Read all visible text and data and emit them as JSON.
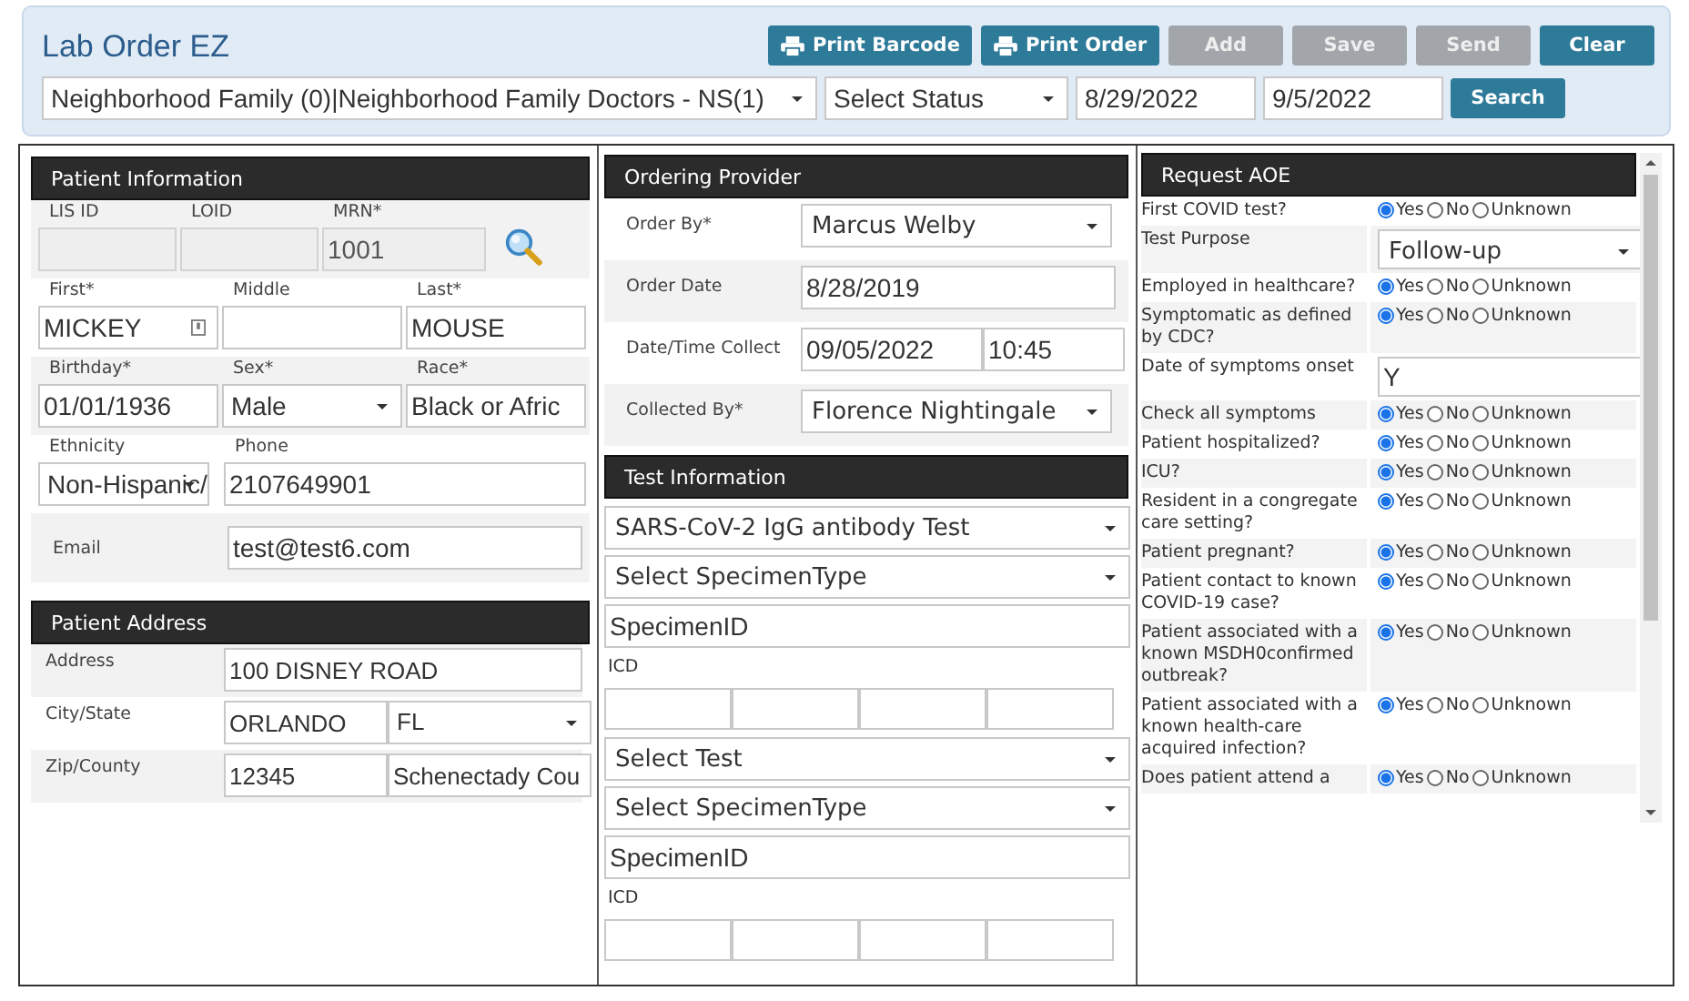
{
  "header": {
    "title": "Lab Order EZ",
    "buttons": [
      {
        "label": "Print Barcode",
        "kind": "print",
        "disabled": false
      },
      {
        "label": "Print Order",
        "kind": "print",
        "disabled": false
      },
      {
        "label": "Add",
        "kind": "plain",
        "disabled": true
      },
      {
        "label": "Save",
        "kind": "plain",
        "disabled": true
      },
      {
        "label": "Send",
        "kind": "plain",
        "disabled": true
      },
      {
        "label": "Clear",
        "kind": "plain",
        "disabled": false
      }
    ]
  },
  "filters": {
    "facility": "Neighborhood Family (0)|Neighborhood Family Doctors - NS(1)",
    "status": "Select Status",
    "date_from": "8/29/2022",
    "date_to": "9/5/2022",
    "search_button": "Search"
  },
  "patient_information": {
    "title": "Patient Information",
    "rows": [
      {
        "kind": "stacked-lookup",
        "fields": [
          {
            "label": "LIS ID",
            "kind": "input",
            "disabled": true
          },
          {
            "label": "LOID",
            "kind": "input",
            "disabled": true
          },
          {
            "label": "MRN*",
            "kind": "input",
            "disabled": true,
            "value": "1001"
          }
        ]
      },
      {
        "kind": "stacked",
        "fields": [
          {
            "label": "First*",
            "kind": "input-icon",
            "disabled": false,
            "value": "MICKEY"
          },
          {
            "label": "Middle",
            "kind": "input",
            "disabled": false
          },
          {
            "label": "Last*",
            "kind": "input",
            "disabled": false,
            "value": "MOUSE"
          }
        ]
      },
      {
        "kind": "stacked",
        "fields": [
          {
            "label": "Birthday*",
            "kind": "input",
            "disabled": false,
            "value": "01/01/1936"
          },
          {
            "label": "Sex*",
            "kind": "select",
            "disabled": false,
            "value": "Male"
          },
          {
            "label": "Race*",
            "kind": "input",
            "disabled": false,
            "value": "Black or Afric"
          }
        ]
      },
      {
        "kind": "stacked",
        "fields": [
          {
            "label": "Ethnicity",
            "kind": "select",
            "disabled": false,
            "value": "Non-Hispanic/"
          },
          {
            "label": "Phone",
            "kind": "input",
            "disabled": false,
            "value": "2107649901"
          }
        ]
      },
      {
        "kind": "inline",
        "fields": [
          {
            "label": "Email",
            "kind": "input",
            "disabled": false,
            "value": "test@test6.com"
          }
        ]
      }
    ]
  },
  "patient_address": {
    "title": "Patient Address",
    "rows": [
      {
        "label": "Address",
        "fields": [
          {
            "kind": "input",
            "value": "100 DISNEY ROAD"
          }
        ]
      },
      {
        "label": "City/State",
        "fields": [
          {
            "kind": "input",
            "value": "ORLANDO"
          },
          {
            "kind": "select",
            "value": "FL"
          }
        ]
      },
      {
        "label": "Zip/County",
        "fields": [
          {
            "kind": "input",
            "value": "12345"
          },
          {
            "kind": "input",
            "value": "Schenectady Cou"
          }
        ]
      }
    ]
  },
  "ordering_provider": {
    "title": "Ordering Provider",
    "rows": [
      {
        "label": "Order By*",
        "fields": [
          {
            "kind": "select",
            "value": "Marcus Welby"
          }
        ]
      },
      {
        "label": "Order Date",
        "fields": [
          {
            "kind": "input",
            "value": "8/28/2019"
          }
        ]
      },
      {
        "label": "Date/Time Collect",
        "fields": [
          {
            "kind": "input",
            "value": "09/05/2022"
          },
          {
            "kind": "input",
            "value": "10:45"
          }
        ]
      },
      {
        "label": "Collected By*",
        "fields": [
          {
            "kind": "select",
            "value": "Florence Nightingale"
          }
        ]
      }
    ]
  },
  "test_information": {
    "title": "Test Information",
    "tests": [
      {
        "test": "SARS-CoV-2 IgG antibody Test",
        "specimen_type": "Select SpecimenType",
        "specimen_id_placeholder": "SpecimenID",
        "icd_label": "ICD"
      },
      {
        "test": "Select Test",
        "specimen_type": "Select SpecimenType",
        "specimen_id_placeholder": "SpecimenID",
        "icd_label": "ICD"
      }
    ]
  },
  "request_aoe": {
    "title": "Request AOE",
    "questions": [
      {
        "label": "First COVID test?",
        "kind": "radio",
        "options": [
          {
            "label": "Yes",
            "selected": true
          },
          {
            "label": "No",
            "selected": false
          },
          {
            "label": "Unknown",
            "selected": false
          }
        ]
      },
      {
        "label": "Test Purpose",
        "kind": "select",
        "value": "Follow-up"
      },
      {
        "label": "Employed in healthcare?",
        "kind": "radio",
        "options": [
          {
            "label": "Yes",
            "selected": true
          },
          {
            "label": "No",
            "selected": false
          },
          {
            "label": "Unknown",
            "selected": false
          }
        ]
      },
      {
        "label": "Symptomatic as defined by CDC?",
        "kind": "radio",
        "options": [
          {
            "label": "Yes",
            "selected": true
          },
          {
            "label": "No",
            "selected": false
          },
          {
            "label": "Unknown",
            "selected": false
          }
        ]
      },
      {
        "label": "Date of symptoms onset",
        "kind": "text",
        "value": "Y"
      },
      {
        "label": "Check all symptoms",
        "kind": "radio",
        "options": [
          {
            "label": "Yes",
            "selected": true
          },
          {
            "label": "No",
            "selected": false
          },
          {
            "label": "Unknown",
            "selected": false
          }
        ]
      },
      {
        "label": "Patient hospitalized?",
        "kind": "radio",
        "options": [
          {
            "label": "Yes",
            "selected": true
          },
          {
            "label": "No",
            "selected": false
          },
          {
            "label": "Unknown",
            "selected": false
          }
        ]
      },
      {
        "label": "ICU?",
        "kind": "radio",
        "options": [
          {
            "label": "Yes",
            "selected": true
          },
          {
            "label": "No",
            "selected": false
          },
          {
            "label": "Unknown",
            "selected": false
          }
        ]
      },
      {
        "label": "Resident in a congregate care setting?",
        "kind": "radio",
        "options": [
          {
            "label": "Yes",
            "selected": true
          },
          {
            "label": "No",
            "selected": false
          },
          {
            "label": "Unknown",
            "selected": false
          }
        ]
      },
      {
        "label": "Patient pregnant?",
        "kind": "radio",
        "options": [
          {
            "label": "Yes",
            "selected": true
          },
          {
            "label": "No",
            "selected": false
          },
          {
            "label": "Unknown",
            "selected": false
          }
        ]
      },
      {
        "label": "Patient contact to known COVID-19 case?",
        "kind": "radio",
        "options": [
          {
            "label": "Yes",
            "selected": true
          },
          {
            "label": "No",
            "selected": false
          },
          {
            "label": "Unknown",
            "selected": false
          }
        ]
      },
      {
        "label": "Patient associated with a known MSDH0confirmed outbreak?",
        "kind": "radio",
        "options": [
          {
            "label": "Yes",
            "selected": true
          },
          {
            "label": "No",
            "selected": false
          },
          {
            "label": "Unknown",
            "selected": false
          }
        ]
      },
      {
        "label": "Patient associated with a known health-care acquired infection?",
        "kind": "radio",
        "options": [
          {
            "label": "Yes",
            "selected": true
          },
          {
            "label": "No",
            "selected": false
          },
          {
            "label": "Unknown",
            "selected": false
          }
        ]
      },
      {
        "label": "Does patient attend a",
        "kind": "radio",
        "options": [
          {
            "label": "Yes",
            "selected": true
          },
          {
            "label": "No",
            "selected": false
          },
          {
            "label": "Unknown",
            "selected": false
          }
        ]
      }
    ]
  }
}
